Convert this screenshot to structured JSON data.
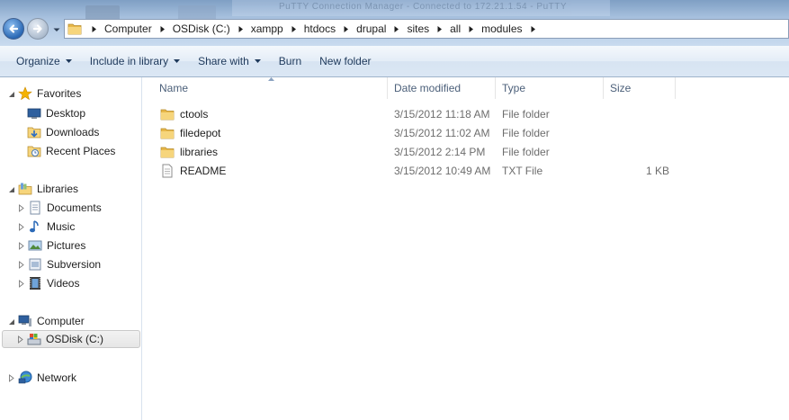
{
  "window": {
    "background_window_title": "PuTTY Connection Manager - Connected to 172.21.1.54 - PuTTY"
  },
  "address_bar": {
    "breadcrumbs": [
      "Computer",
      "OSDisk (C:)",
      "xampp",
      "htdocs",
      "drupal",
      "sites",
      "all",
      "modules"
    ]
  },
  "toolbar": {
    "organize_label": "Organize",
    "include_label": "Include in library",
    "share_label": "Share with",
    "burn_label": "Burn",
    "new_folder_label": "New folder"
  },
  "nav": {
    "favorites": "Favorites",
    "desktop": "Desktop",
    "downloads": "Downloads",
    "recent_places": "Recent Places",
    "libraries": "Libraries",
    "documents": "Documents",
    "music": "Music",
    "pictures": "Pictures",
    "subversion": "Subversion",
    "videos": "Videos",
    "computer": "Computer",
    "osdisk": "OSDisk (C:)",
    "network": "Network"
  },
  "columns": {
    "name": "Name",
    "date_modified": "Date modified",
    "type": "Type",
    "size": "Size"
  },
  "files": [
    {
      "name": "ctools",
      "date": "3/15/2012 11:18 AM",
      "type": "File folder",
      "size": "",
      "icon": "folder-icon"
    },
    {
      "name": "filedepot",
      "date": "3/15/2012 11:02 AM",
      "type": "File folder",
      "size": "",
      "icon": "folder-icon"
    },
    {
      "name": "libraries",
      "date": "3/15/2012 2:14 PM",
      "type": "File folder",
      "size": "",
      "icon": "folder-icon"
    },
    {
      "name": "README",
      "date": "3/15/2012 10:49 AM",
      "type": "TXT File",
      "size": "1 KB",
      "icon": "text-file-icon"
    }
  ],
  "colors": {
    "accent": "#1e395b",
    "header_text": "#4c607a",
    "selection": "#e6e6e6"
  }
}
